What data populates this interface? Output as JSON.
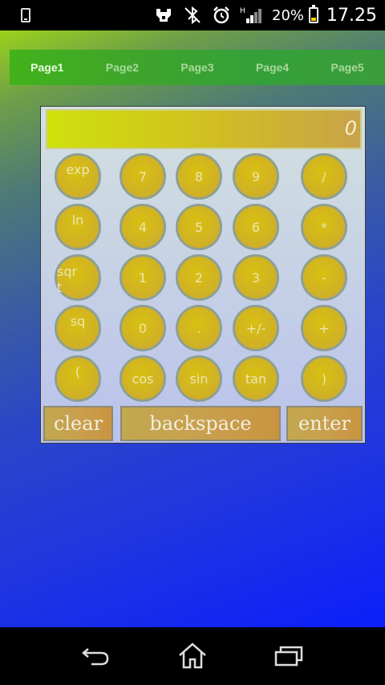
{
  "status_bar": {
    "battery_percent": "20%",
    "time": "17.25",
    "network_type": "H",
    "icons": [
      "sim-card-icon",
      "usb-connection-icon",
      "bluetooth-off-icon",
      "alarm-clock-icon",
      "signal-icon",
      "battery-icon"
    ]
  },
  "tabs": [
    {
      "label": "Page1",
      "active": true
    },
    {
      "label": "Page2",
      "active": false
    },
    {
      "label": "Page3",
      "active": false
    },
    {
      "label": "Page4",
      "active": false
    },
    {
      "label": "Page5",
      "active": false
    }
  ],
  "display": {
    "value": "0"
  },
  "keys": {
    "exp": "exp",
    "k7": "7",
    "k8": "8",
    "k9": "9",
    "div": "/",
    "ln": "ln",
    "k4": "4",
    "k5": "5",
    "k6": "6",
    "mul": "*",
    "sqrt_line1": "sqr",
    "sqrt_line2": "t",
    "k1": "1",
    "k2": "2",
    "k3": "3",
    "sub": "-",
    "sq": "sq",
    "k0": "0",
    "dot": ".",
    "neg": "+/-",
    "add": "+",
    "lparen": "(",
    "cos": "cos",
    "sin": "sin",
    "tan": "tan",
    "rparen": ")"
  },
  "actions": {
    "clear": "clear",
    "backspace": "backspace",
    "enter": "enter"
  },
  "nav": {
    "icons": [
      "back-icon",
      "home-icon",
      "recent-apps-icon"
    ]
  },
  "colors": {
    "tab_bar": "#3ea52b",
    "key_fill": "#d0b126",
    "display_fill": "#cfe10c"
  }
}
